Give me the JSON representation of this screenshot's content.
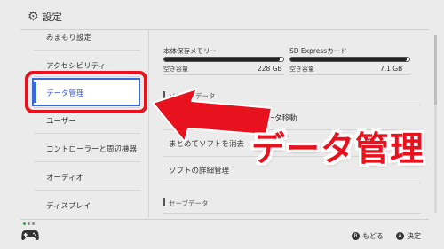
{
  "header": {
    "title": "設定",
    "icon": "gear-icon"
  },
  "sidebar": {
    "items": [
      {
        "label": "みまもり設定"
      },
      {
        "label": "アクセシビリティ"
      },
      {
        "label": "データ管理",
        "selected": true
      },
      {
        "label": "ユーザー"
      },
      {
        "label": "コントローラーと周辺機器"
      },
      {
        "label": "オーディオ"
      },
      {
        "label": "ディスプレイ"
      }
    ]
  },
  "storage": {
    "internal": {
      "label": "本体保存メモリー",
      "free_label": "空き容量",
      "free_value": "228 GB",
      "used_fraction": 0.97
    },
    "sd": {
      "label": "SD Expressカード",
      "free_label": "空き容量",
      "free_value": "7.1 GB",
      "used_fraction": 0.98
    }
  },
  "main": {
    "software_section": "ソフトのデータ",
    "items": [
      {
        "label": "ressカード間のデータ移動"
      },
      {
        "label": "まとめてソフトを消去"
      },
      {
        "label": "ソフトの詳細管理"
      }
    ],
    "save_section": "セーブデータ"
  },
  "footer": {
    "back": {
      "key": "B",
      "label": "もどる"
    },
    "ok": {
      "key": "A",
      "label": "決定"
    }
  },
  "callout": {
    "text": "データ管理"
  },
  "colors": {
    "accent": "#3a68d8",
    "callout": "#e8121e",
    "background": "#ebebeb"
  }
}
